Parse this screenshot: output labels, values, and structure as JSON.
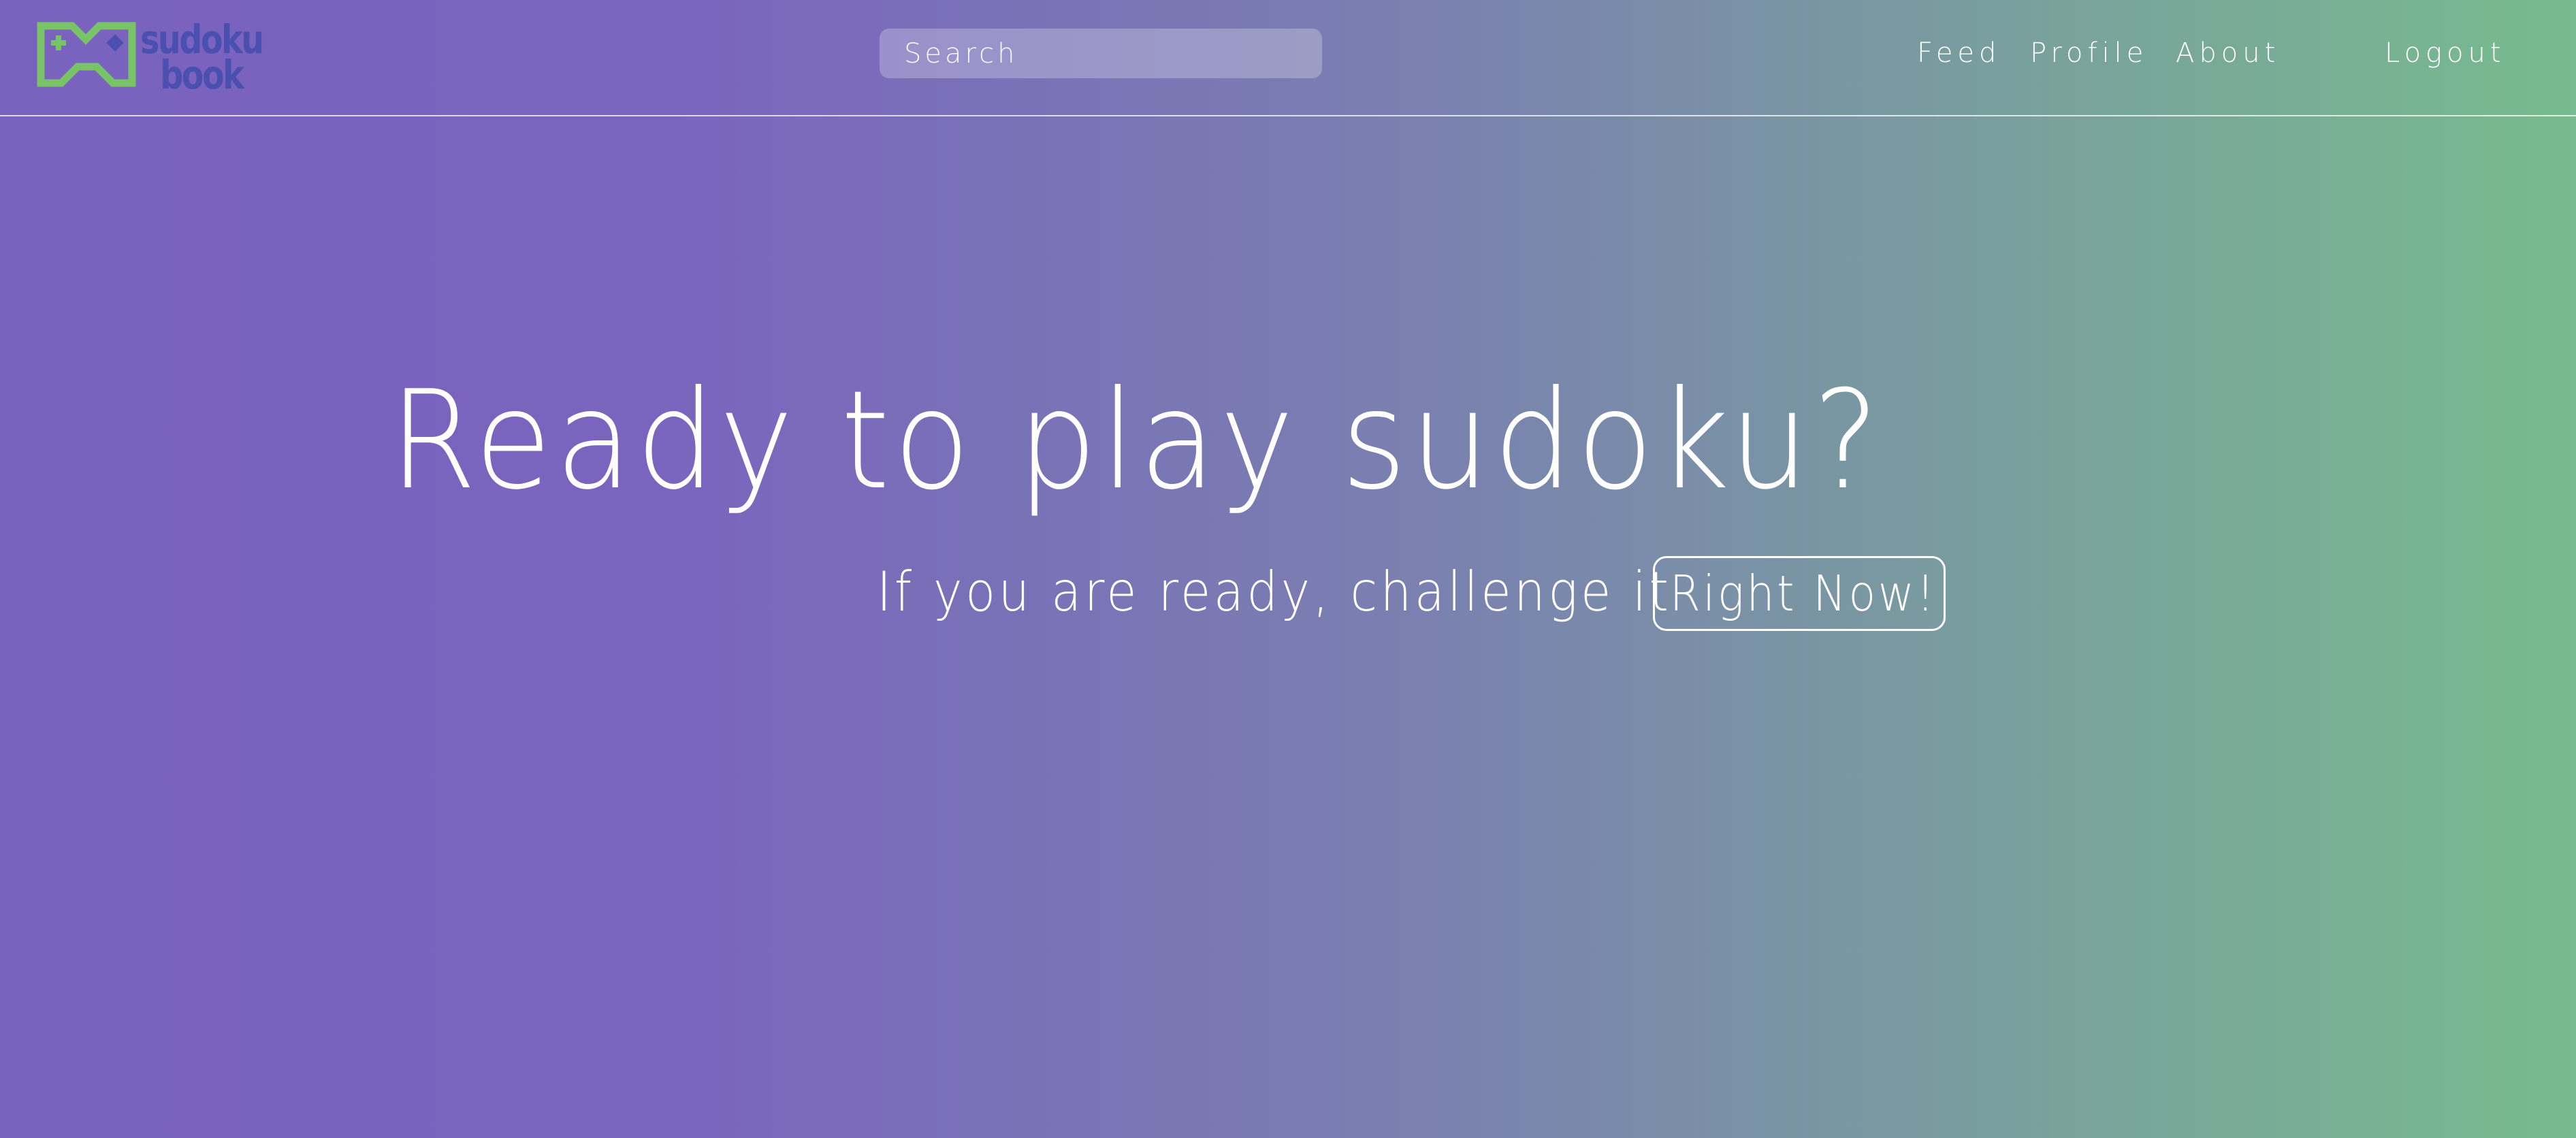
{
  "logo": {
    "line1": "sudoku",
    "line2": "book",
    "icon": "gamepad-icon",
    "colors": {
      "frame": "#79c367",
      "text": "#4a4fb0"
    }
  },
  "search": {
    "placeholder": "Search",
    "value": ""
  },
  "nav": {
    "feed": "Feed",
    "profile": "Profile",
    "about": "About",
    "logout": "Logout"
  },
  "hero": {
    "title": "Ready to play sudoku?",
    "subtitle": "If you are ready, challenge it",
    "cta": "Right Now!"
  },
  "colors": {
    "gradient_start": "#7a62bf",
    "gradient_end": "#78bb8e",
    "text": "#ffffff"
  }
}
